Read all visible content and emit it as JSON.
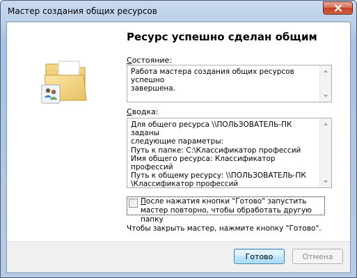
{
  "window": {
    "title": "Мастер создания общих ресурсов"
  },
  "main": {
    "heading": "Ресурс успешно сделан общим",
    "status_label_first": "С",
    "status_label_rest": "остояние:",
    "status_text": "Работа мастера создания общих ресурсов успешно\nзавершена.",
    "summary_label_first": "С",
    "summary_label_rest": "водка:",
    "summary_text": "Для общего ресурса \\\\ПОЛЬЗОВАТЕЛЬ-ПК заданы\nследующие параметры:\nПуть к папке: C:\\Классификатор профессий\nИмя общего ресурса: Классификатор профессий\nПуть к общему ресурсу: \\\\ПОЛЬЗОВАТЕЛЬ-ПК\n\\Классификатор профессий",
    "checkbox_label_first": "П",
    "checkbox_label_rest": "осле нажатия кнопки \"Готово\" запустить мастер повторно, чтобы обработать другую папку",
    "checkbox_checked": false,
    "hint": "Чтобы закрыть мастер, нажмите кнопку \"Готово\"."
  },
  "footer": {
    "finish_label": "Готово",
    "cancel_label": "Отмена"
  },
  "icons": {
    "title_close": "close-icon",
    "wizard_art": "shared-folder-icon"
  },
  "colors": {
    "accent_button_border": "#3c7fb1",
    "close_button": "#c44124"
  }
}
